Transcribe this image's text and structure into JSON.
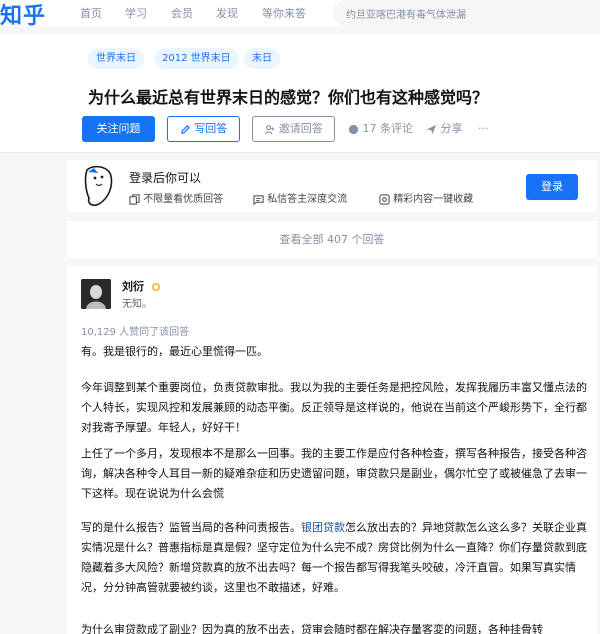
{
  "nav": {
    "logo": "知乎",
    "items": [
      "首页",
      "学习",
      "会员",
      "发现",
      "等你来答"
    ],
    "search_placeholder": "约旦亚喀巴港有毒气体泄漏"
  },
  "question": {
    "tags": [
      "世界末日",
      "2012 世界末日",
      "末日"
    ],
    "title": "为什么最近总有世界末日的感觉？你们也有这种感觉吗？",
    "follow_label": "关注问题",
    "write_label": "写回答",
    "invite_label": "邀请回答",
    "comments_label": "17 条评论",
    "share_label": "分享",
    "more_label": "···"
  },
  "login_card": {
    "title": "登录后你可以",
    "perks": [
      "不限量看优质回答",
      "私信答主深度交流",
      "精彩内容一键收藏"
    ],
    "login_label": "登录"
  },
  "view_all": "查看全部 407 个回答",
  "answer": {
    "author": "刘衍",
    "bio": "无知。",
    "voters": "10,129 人赞同了该回答",
    "p1": "有。我是银行的，最近心里慌得一匹。",
    "p2": "今年调整到某个重要岗位，负责贷款审批。我以为我的主要任务是把控风险，发挥我履历丰富又懂点法的个人特长，实现风控和发展兼顾的动态平衡。反正领导是这样说的，他说在当前这个严峻形势下，全行都对我寄予厚望。年轻人，好好干！",
    "p3": "上任了一个多月，发现根本不是那么一回事。我的主要工作是应付各种检查，撰写各种报告，接受各种咨询，解决各种令人耳目一新的疑难杂症和历史遗留问题，审贷款只是副业，偶尔忙空了或被催急了去审一下这样。现在说说为什么会慌",
    "p4_before": "写的是什么报告？监管当局的各种问责报告。",
    "p4_link": "银团贷款",
    "p4_after": "怎么放出去的？异地贷款怎么这么多？关联企业真实情况是什么？普惠指标是真是假？坚守定位为什么完不成？房贷比例为什么一直降？你们存量贷款到底隐藏着多大风险？新增贷款真的放不出去吗？每一个报告都写得我笔头咬破，冷汗直冒。如果写真实情况，分分钟高管就要被约谈，这里也不敢描述，好难。",
    "p5": "为什么审贷款成了副业？因为真的放不出去，贷审会随时都在解决存量客変的问题，各种挂骨转"
  }
}
